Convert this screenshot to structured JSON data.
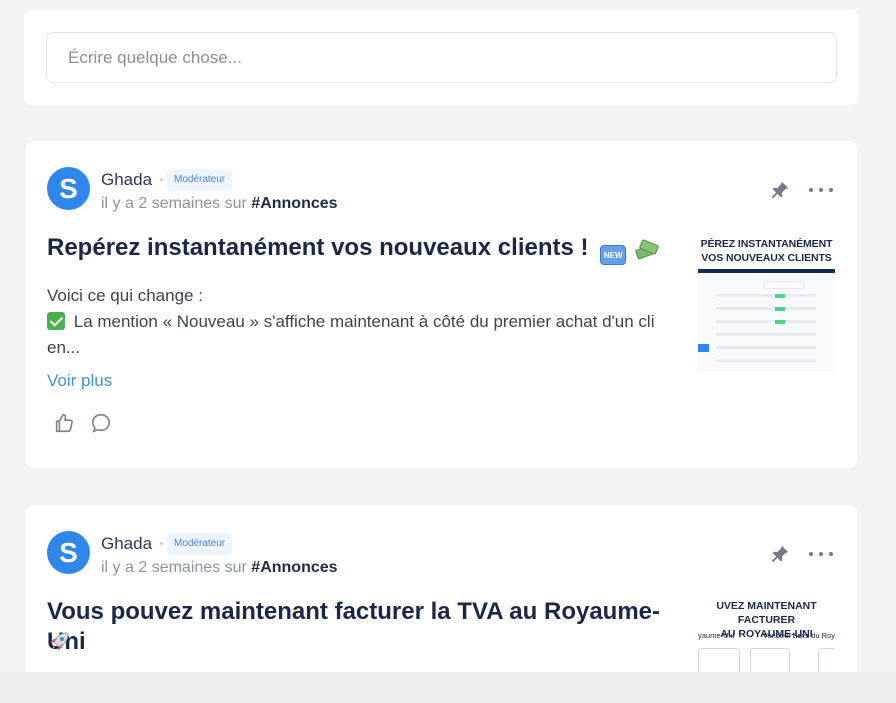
{
  "composer": {
    "placeholder": "Écrire quelque chose..."
  },
  "posts": [
    {
      "author": "Ghada",
      "avatar_letter": "S",
      "badge": "Modérateur",
      "meta_prefix": "il y a 2 semaines sur",
      "tag": "#Annonces",
      "title": "Repérez instantanément vos nouveaux clients !",
      "emoji_new": "NEW",
      "body_line1": "Voici ce qui change :",
      "body_line2": "La mention « Nouveau » s'affiche maintenant à côté du premier achat d'un cli",
      "body_line3": "en...",
      "see_more": "Voir plus",
      "thumbnail": {
        "title_line1": "PÉREZ INSTANTANÉMENT",
        "title_line2": "VOS NOUVEAUX CLIENTS"
      }
    },
    {
      "author": "Ghada",
      "avatar_letter": "S",
      "badge": "Modérateur",
      "meta_prefix": "il y a 2 semaines sur",
      "tag": "#Annonces",
      "title": "Vous pouvez maintenant facturer la TVA au Royaume-Uni",
      "thumbnail": {
        "title_line1": "UVEZ MAINTENANT FACTURER",
        "title_line2": "AU ROYAUME-UNI",
        "left_label": "yaume-Uni",
        "right_label_prefix": "Vendeur ",
        "right_label_bold": "hors",
        "right_label_suffix": " du Roy"
      }
    }
  ],
  "colors": {
    "background": "#f1f3f6",
    "card": "#ffffff",
    "brand": "#2f87ea",
    "link": "#3f92d2",
    "badge_bg": "#edf4ff",
    "badge_text": "#4b86d8"
  },
  "icons": {
    "pin": "pin-icon",
    "more": "more-icon",
    "like": "thumb-up-icon",
    "comment": "comment-icon",
    "rocket": "rocket-icon",
    "check": "check-icon"
  }
}
